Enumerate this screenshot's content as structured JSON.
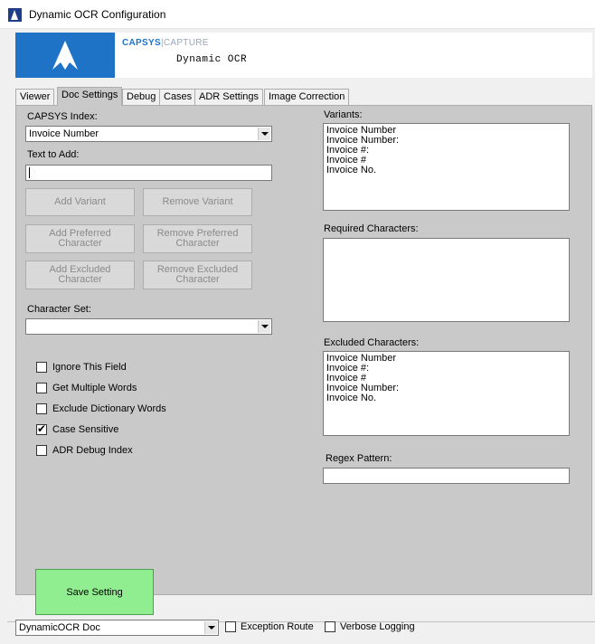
{
  "window": {
    "title": "Dynamic OCR Configuration"
  },
  "banner": {
    "brand_primary": "CAPSYS",
    "brand_separator": "|",
    "brand_secondary": "CAPTURE",
    "subtitle": "Dynamic OCR"
  },
  "tabs": [
    {
      "label": "Viewer"
    },
    {
      "label": "Doc Settings"
    },
    {
      "label": "Debug"
    },
    {
      "label": "Cases"
    },
    {
      "label": "ADR Settings"
    },
    {
      "label": "Image Correction"
    }
  ],
  "left": {
    "capsys_index_label": "CAPSYS Index:",
    "capsys_index_value": "Invoice Number",
    "text_to_add_label": "Text to Add:",
    "text_to_add_value": "",
    "buttons": {
      "add_variant": "Add Variant",
      "remove_variant": "Remove Variant",
      "add_preferred": "Add Preferred\nCharacter",
      "remove_preferred": "Remove Preferred\nCharacter",
      "add_excluded": "Add Excluded\nCharacter",
      "remove_excluded": "Remove Excluded\nCharacter"
    },
    "character_set_label": "Character Set:",
    "character_set_value": "",
    "checkboxes": [
      {
        "label": "Ignore This Field",
        "checked": false
      },
      {
        "label": "Get Multiple Words",
        "checked": false
      },
      {
        "label": "Exclude Dictionary Words",
        "checked": false
      },
      {
        "label": "Case Sensitive",
        "checked": true
      },
      {
        "label": "ADR Debug Index",
        "checked": false
      }
    ],
    "save_label": "Save Setting"
  },
  "right": {
    "variants_label": "Variants:",
    "variants": [
      "Invoice Number",
      "Invoice Number:",
      "Invoice #:",
      "Invoice #",
      "Invoice No."
    ],
    "required_label": "Required Characters:",
    "required": [],
    "excluded_label": "Excluded Characters:",
    "excluded": [
      "Invoice Number",
      "Invoice #:",
      "Invoice #",
      "Invoice Number:",
      "Invoice No."
    ],
    "regex_label": "Regex Pattern:",
    "regex_value": ""
  },
  "bottom": {
    "doc_type_value": "DynamicOCR Doc",
    "exception_route_label": "Exception Route",
    "exception_route_checked": false,
    "verbose_logging_label": "Verbose Logging",
    "verbose_logging_checked": false
  }
}
